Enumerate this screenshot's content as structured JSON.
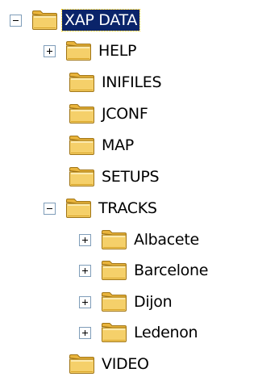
{
  "tree": {
    "root": {
      "label": "XAP DATA",
      "state": "collapse",
      "selected": true
    },
    "help": {
      "label": "HELP",
      "state": "expand"
    },
    "inifiles": {
      "label": "INIFILES"
    },
    "jconf": {
      "label": "JCONF"
    },
    "map": {
      "label": "MAP"
    },
    "setups": {
      "label": "SETUPS"
    },
    "tracks": {
      "label": "TRACKS",
      "state": "collapse",
      "children": [
        {
          "label": "Albacete",
          "state": "expand"
        },
        {
          "label": "Barcelone",
          "state": "expand"
        },
        {
          "label": "Dijon",
          "state": "expand"
        },
        {
          "label": "Ledenon",
          "state": "expand"
        }
      ]
    },
    "video": {
      "label": "VIDEO"
    }
  },
  "colors": {
    "folder": "#f2c94c",
    "folder_dark": "#b8860b",
    "selection_bg": "#0a246a",
    "selection_fg": "#ffffff",
    "expander_border": "#7f9db9"
  },
  "icons": {
    "folder": "folder-icon",
    "expand": "plus-icon",
    "collapse": "minus-icon"
  }
}
